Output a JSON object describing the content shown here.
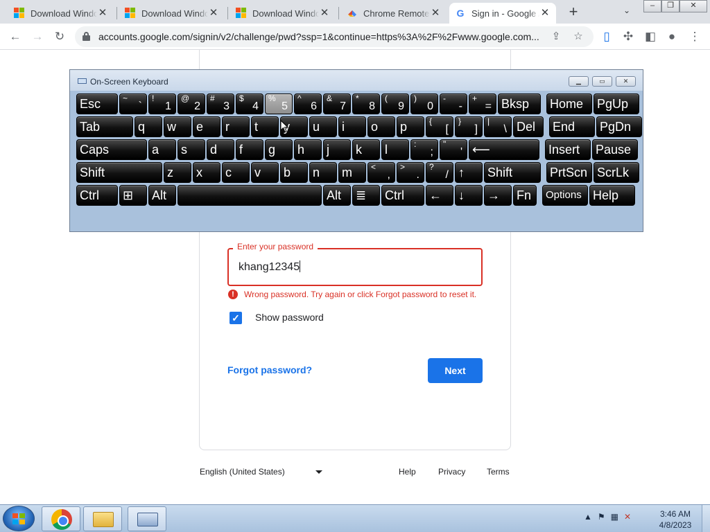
{
  "browser": {
    "tabs": [
      {
        "title": "Download Windo",
        "icon": "microsoft-logo-icon",
        "active": false
      },
      {
        "title": "Download Windo",
        "icon": "microsoft-logo-icon",
        "active": false
      },
      {
        "title": "Download Windo",
        "icon": "microsoft-logo-icon",
        "active": false
      },
      {
        "title": "Chrome Remote D",
        "icon": "chrome-remote-desktop-icon",
        "active": false
      },
      {
        "title": "Sign in - Google A",
        "icon": "google-g-icon",
        "active": true
      }
    ],
    "new_tab_glyph": "+",
    "url": "accounts.google.com/signin/v2/challenge/pwd?ssp=1&continue=https%3A%2F%2Fwww.google.com..."
  },
  "osk": {
    "title": "On-Screen Keyboard",
    "rows": [
      [
        {
          "main": "Esc"
        },
        {
          "shift": "~",
          "lo": "`"
        },
        {
          "shift": "!",
          "lo": "1"
        },
        {
          "shift": "@",
          "lo": "2"
        },
        {
          "shift": "#",
          "lo": "3"
        },
        {
          "shift": "$",
          "lo": "4"
        },
        {
          "shift": "%",
          "lo": "5",
          "pressed": true
        },
        {
          "shift": "^",
          "lo": "6"
        },
        {
          "shift": "&",
          "lo": "7"
        },
        {
          "shift": "*",
          "lo": "8"
        },
        {
          "shift": "(",
          "lo": "9"
        },
        {
          "shift": ")",
          "lo": "0"
        },
        {
          "shift": "-",
          "lo": "-"
        },
        {
          "shift": "+",
          "lo": "="
        },
        {
          "main": "Bksp"
        },
        {
          "main": "Home"
        },
        {
          "main": "PgUp"
        }
      ],
      [
        {
          "main": "Tab"
        },
        {
          "main": "q"
        },
        {
          "main": "w"
        },
        {
          "main": "e"
        },
        {
          "main": "r"
        },
        {
          "main": "t"
        },
        {
          "main": "y"
        },
        {
          "main": "u"
        },
        {
          "main": "i"
        },
        {
          "main": "o"
        },
        {
          "main": "p"
        },
        {
          "shift": "{",
          "lo": "["
        },
        {
          "shift": "}",
          "lo": "]"
        },
        {
          "shift": "|",
          "lo": "\\"
        },
        {
          "main": "Del"
        },
        {
          "main": "End"
        },
        {
          "main": "PgDn"
        }
      ],
      [
        {
          "main": "Caps"
        },
        {
          "main": "a"
        },
        {
          "main": "s"
        },
        {
          "main": "d"
        },
        {
          "main": "f"
        },
        {
          "main": "g"
        },
        {
          "main": "h"
        },
        {
          "main": "j"
        },
        {
          "main": "k"
        },
        {
          "main": "l"
        },
        {
          "shift": ":",
          "lo": ";"
        },
        {
          "shift": "\"",
          "lo": "'"
        },
        {
          "main": "⟵"
        },
        {
          "main": "Insert"
        },
        {
          "main": "Pause"
        }
      ],
      [
        {
          "main": "Shift"
        },
        {
          "main": "z"
        },
        {
          "main": "x"
        },
        {
          "main": "c"
        },
        {
          "main": "v"
        },
        {
          "main": "b"
        },
        {
          "main": "n"
        },
        {
          "main": "m"
        },
        {
          "shift": "<",
          "lo": ","
        },
        {
          "shift": ">",
          "lo": "."
        },
        {
          "shift": "?",
          "lo": "/"
        },
        {
          "main": "↑"
        },
        {
          "main": "Shift"
        },
        {
          "main": "PrtScn"
        },
        {
          "main": "ScrLk"
        }
      ],
      [
        {
          "main": "Ctrl"
        },
        {
          "main": "⊞"
        },
        {
          "main": "Alt"
        },
        {
          "main": ""
        },
        {
          "main": "Alt"
        },
        {
          "main": "≣"
        },
        {
          "main": "Ctrl"
        },
        {
          "main": "←"
        },
        {
          "main": "↓"
        },
        {
          "main": "→"
        },
        {
          "main": "Fn"
        },
        {
          "main": "Options",
          "small": true
        },
        {
          "main": "Help"
        }
      ]
    ]
  },
  "signin": {
    "password_label": "Enter your password",
    "password_value": "khang12345",
    "error_text": "Wrong password. Try again or click Forgot password to reset it.",
    "show_password_label": "Show password",
    "show_password_checked": true,
    "forgot_link": "Forgot password?",
    "next_button": "Next"
  },
  "footer": {
    "language": "English (United States)",
    "links": [
      "Help",
      "Privacy",
      "Terms"
    ]
  },
  "taskbar": {
    "apps": [
      "chrome-icon",
      "file-explorer-icon",
      "on-screen-keyboard-icon"
    ],
    "time": "3:46 AM",
    "date": "4/8/2023"
  },
  "colors": {
    "accent": "#1a73e8",
    "error": "#d93025"
  }
}
